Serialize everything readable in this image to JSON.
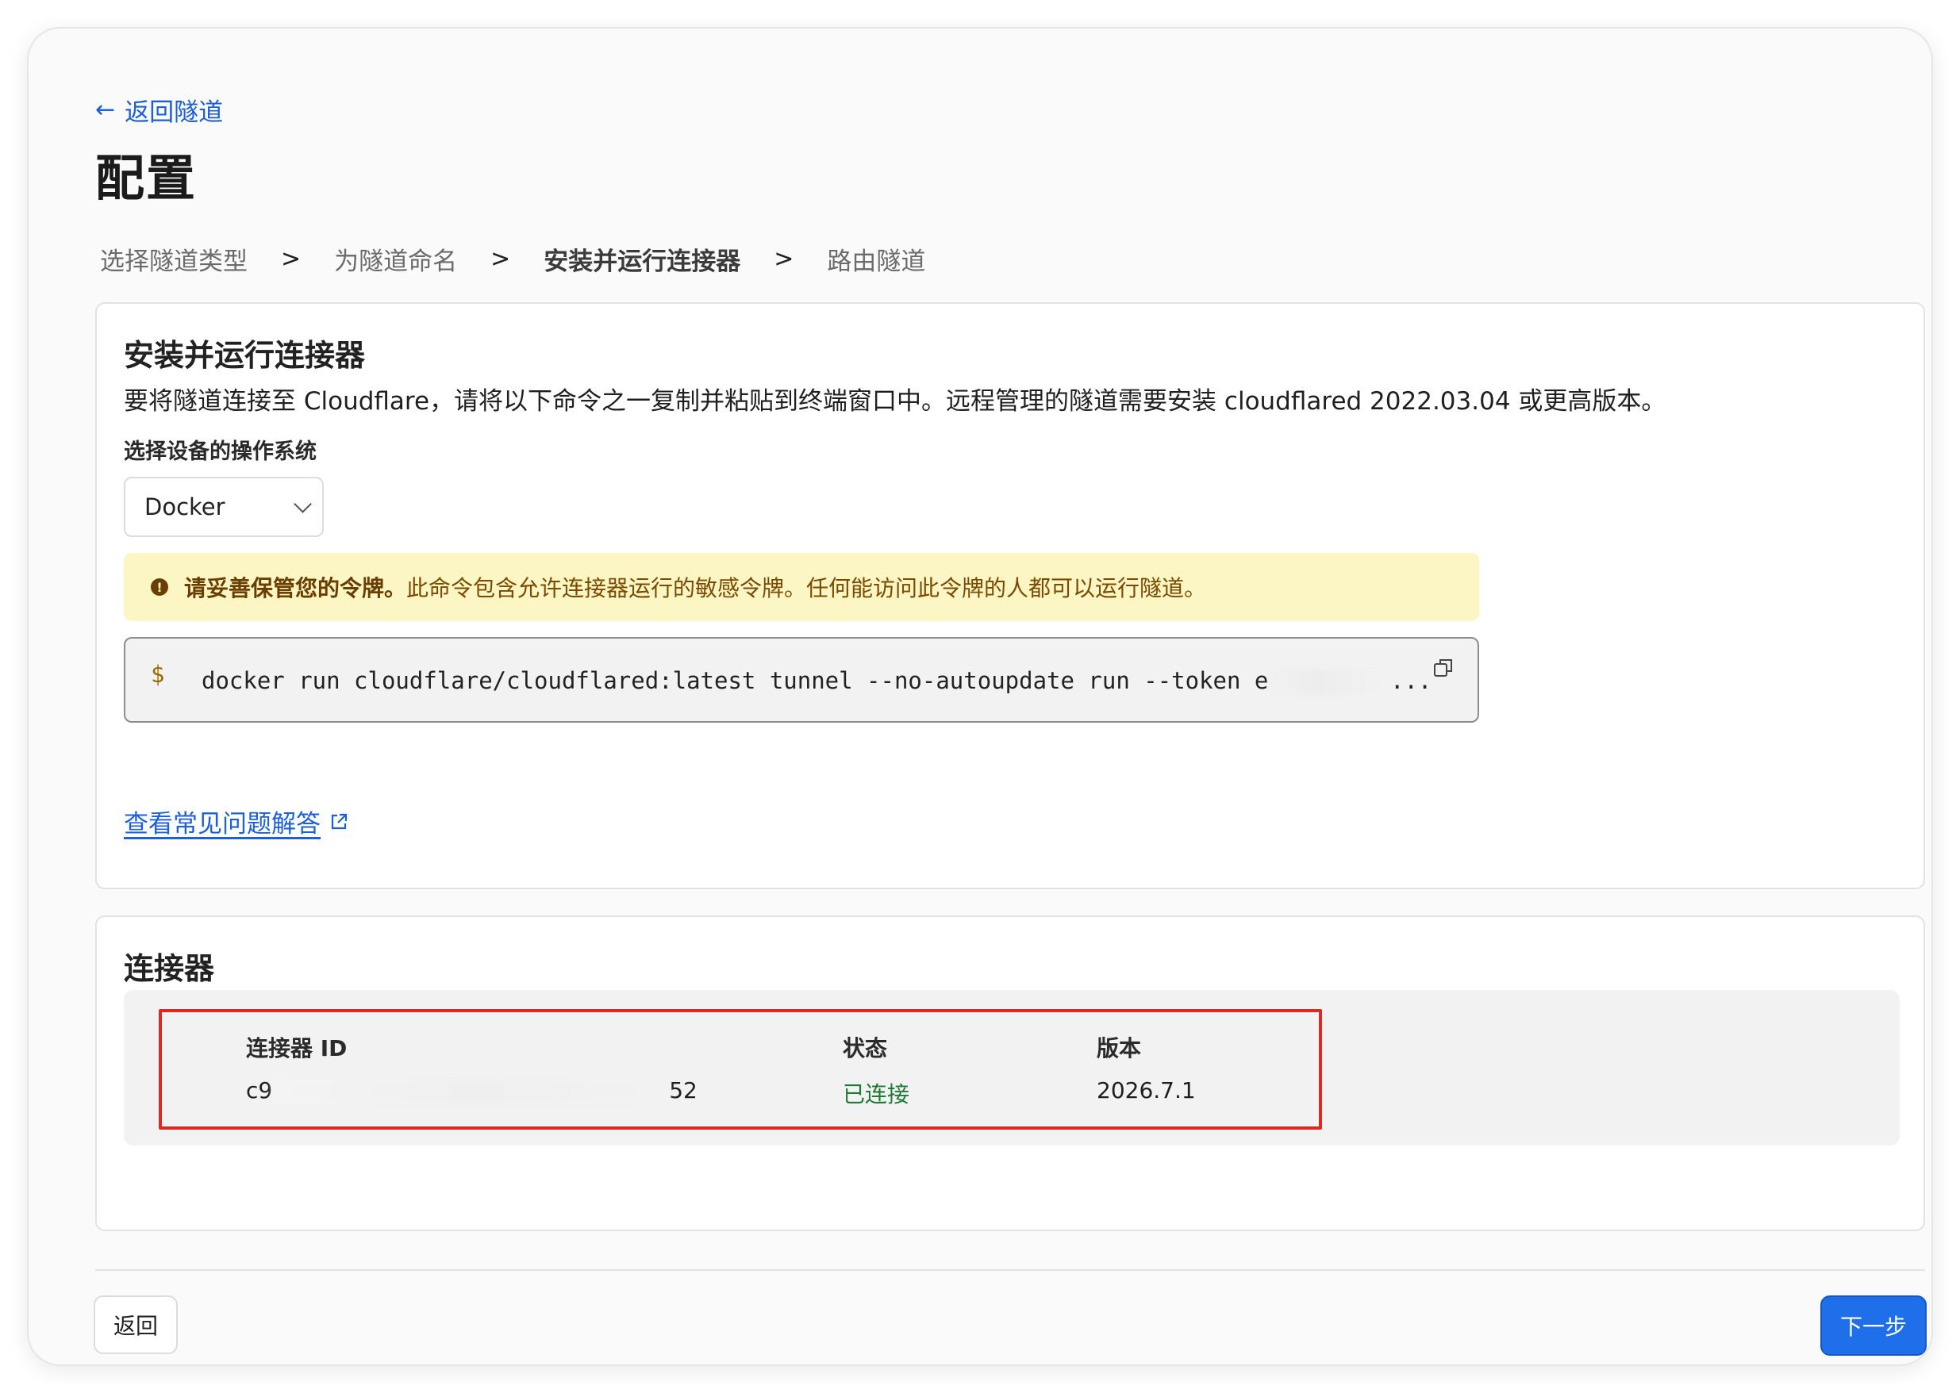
{
  "nav": {
    "back_icon": "arrow-left-icon",
    "back_glyph": "←",
    "back_label": "返回隧道"
  },
  "page": {
    "title": "配置"
  },
  "steps": [
    {
      "label": "选择隧道类型",
      "active": false
    },
    {
      "label": "为隧道命名",
      "active": false
    },
    {
      "label": "安装并运行连接器",
      "active": true
    },
    {
      "label": "路由隧道",
      "active": false
    }
  ],
  "step_separator": ">",
  "install": {
    "title": "安装并运行连接器",
    "description": "要将隧道连接至 Cloudflare，请将以下命令之一复制并粘贴到终端窗口中。远程管理的隧道需要安装 cloudflared 2022.03.04 或更高版本。",
    "os_label": "选择设备的操作系统",
    "os_selected": "Docker",
    "alert": {
      "icon": "warning-icon",
      "glyph": "!",
      "strong": "请妥善保管您的令牌。",
      "text": "此命令包含允许连接器运行的敏感令牌。任何能访问此令牌的人都可以运行隧道。",
      "background": "#fcf6c4"
    },
    "command": {
      "prompt": "$",
      "text": "docker run cloudflare/cloudflared:latest tunnel --no-autoupdate run --token e",
      "ellipsis": "...",
      "copy_icon": "copy-icon"
    },
    "faq_link": "查看常见问题解答",
    "faq_icon": "external-link-icon"
  },
  "connectors": {
    "title": "连接器",
    "columns": {
      "id": "连接器 ID",
      "status": "状态",
      "version": "版本"
    },
    "rows": [
      {
        "id_start": "c9",
        "id_end": "52",
        "status": "已连接",
        "version": "2026.7.1"
      }
    ],
    "highlight_color": "#e0281e",
    "status_color": "#1e7a35"
  },
  "footer": {
    "back_label": "返回",
    "next_label": "下一步",
    "next_color": "#1f6fea"
  }
}
